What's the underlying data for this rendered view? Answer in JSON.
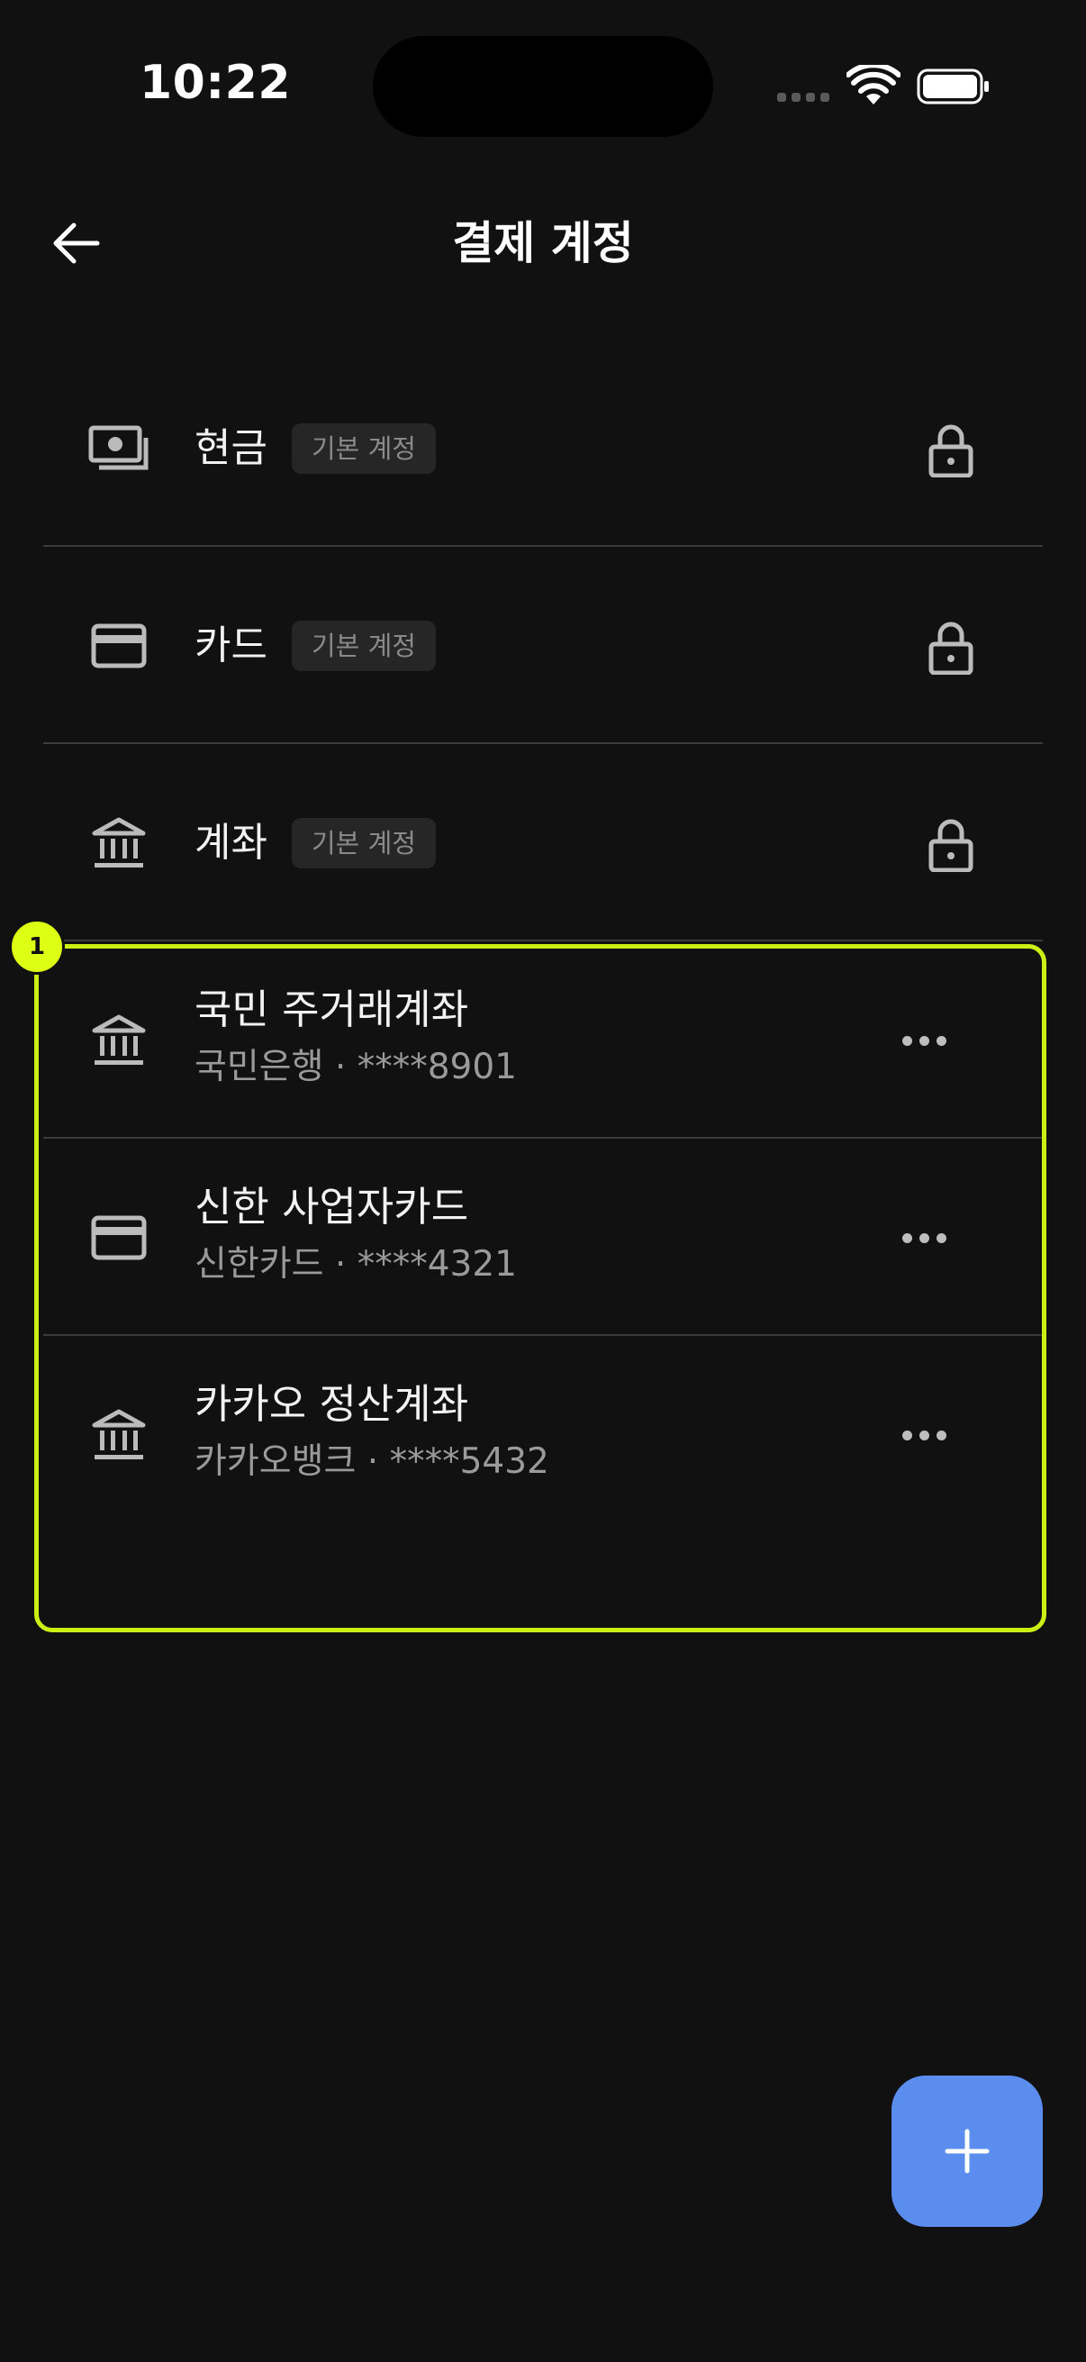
{
  "status_bar": {
    "time": "10:22"
  },
  "header": {
    "title": "결제 계정"
  },
  "default_accounts": [
    {
      "icon": "cash-icon",
      "label": "현금",
      "badge": "기본 계정"
    },
    {
      "icon": "card-icon",
      "label": "카드",
      "badge": "기본 계정"
    },
    {
      "icon": "bank-icon",
      "label": "계좌",
      "badge": "기본 계정"
    }
  ],
  "custom_accounts": [
    {
      "icon": "bank-icon",
      "name": "국민 주거래계좌",
      "detail": "국민은행 · ****8901"
    },
    {
      "icon": "card-icon",
      "name": "신한 사업자카드",
      "detail": "신한카드 · ****4321"
    },
    {
      "icon": "bank-icon",
      "name": "카카오 정산계좌",
      "detail": "카카오뱅크 · ****5432"
    }
  ],
  "highlight": {
    "label": "1",
    "color": "#ccf014"
  },
  "colors": {
    "background": "#111111",
    "accent": "#5b8dee"
  }
}
